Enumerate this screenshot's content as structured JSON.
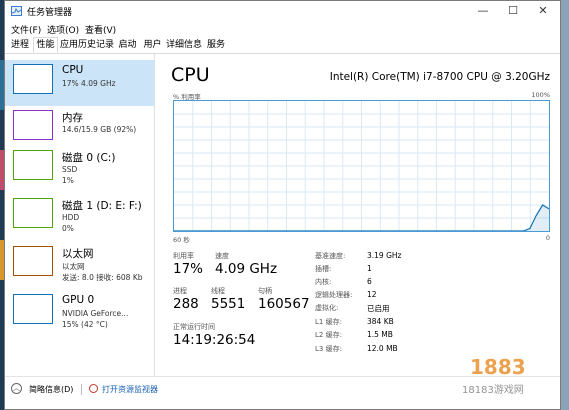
{
  "window": {
    "title": "任务管理器",
    "buttons": {
      "minimize": "—",
      "maximize": "☐",
      "close": "✕"
    }
  },
  "menu": [
    "文件(F)",
    "选项(O)",
    "查看(V)"
  ],
  "tabs": [
    {
      "label": "进程",
      "active": false
    },
    {
      "label": "性能",
      "active": true
    },
    {
      "label": "应用历史记录",
      "active": false
    },
    {
      "label": "启动",
      "active": false
    },
    {
      "label": "用户",
      "active": false
    },
    {
      "label": "详细信息",
      "active": false
    },
    {
      "label": "服务",
      "active": false
    }
  ],
  "resources": [
    {
      "name": "CPU",
      "line1": "17% 4.09 GHz",
      "line2": "",
      "color": "#1170b7",
      "selected": true
    },
    {
      "name": "内存",
      "line1": "14.6/15.9 GB (92%)",
      "line2": "",
      "color": "#8b2fc9",
      "selected": false
    },
    {
      "name": "磁盘 0 (C:)",
      "line1": "SSD",
      "line2": "1%",
      "color": "#4da60c",
      "selected": false
    },
    {
      "name": "磁盘 1 (D: E: F:)",
      "line1": "HDD",
      "line2": "0%",
      "color": "#4da60c",
      "selected": false
    },
    {
      "name": "以太网",
      "line1": "以太网",
      "line2": "发送: 8.0 接收: 608 Kb",
      "color": "#a74f01",
      "selected": false
    },
    {
      "name": "GPU 0",
      "line1": "NVIDIA GeForce...",
      "line2": "15% (42 °C)",
      "color": "#1170b7",
      "selected": false
    }
  ],
  "detail": {
    "title": "CPU",
    "model": "Intel(R) Core(TM) i7-8700 CPU @ 3.20GHz",
    "graph_label_top_left": "% 利用率",
    "graph_label_top_right": "100%",
    "graph_label_bottom_left": "60 秒",
    "graph_label_bottom_right": "0",
    "graph_color": "#1170b7",
    "utilization_history": [
      0,
      0,
      0,
      0,
      0,
      0,
      0,
      0,
      0,
      0,
      0,
      0,
      0,
      0,
      0,
      0,
      0,
      0,
      0,
      0,
      0,
      0,
      0,
      0,
      0,
      0,
      0,
      0,
      0,
      0,
      0,
      0,
      0,
      0,
      0,
      0,
      0,
      0,
      0,
      0,
      0,
      0,
      0,
      0,
      0,
      0,
      0,
      0,
      0,
      0,
      0,
      0,
      0,
      0,
      0,
      0,
      2,
      12,
      20,
      17
    ],
    "stats": {
      "utilization_label": "利用率",
      "utilization_value": "17%",
      "speed_label": "速度",
      "speed_value": "4.09 GHz",
      "processes_label": "进程",
      "processes_value": "288",
      "threads_label": "线程",
      "threads_value": "5551",
      "handles_label": "句柄",
      "handles_value": "160567",
      "uptime_label": "正常运行时间",
      "uptime_value": "14:19:26:54"
    },
    "specs": [
      {
        "key": "基准速度:",
        "value": "3.19 GHz"
      },
      {
        "key": "插槽:",
        "value": "1"
      },
      {
        "key": "内核:",
        "value": "6"
      },
      {
        "key": "逻辑处理器:",
        "value": "12"
      },
      {
        "key": "虚拟化:",
        "value": "已启用"
      },
      {
        "key": "L1 缓存:",
        "value": "384 KB"
      },
      {
        "key": "L2 缓存:",
        "value": "1.5 MB"
      },
      {
        "key": "L3 缓存:",
        "value": "12.0 MB"
      }
    ]
  },
  "footer": {
    "less_info": "简略信息(D)",
    "open_monitor": "打开资源监视器"
  },
  "watermark": {
    "logo": "1883",
    "site": "18183游戏网"
  }
}
